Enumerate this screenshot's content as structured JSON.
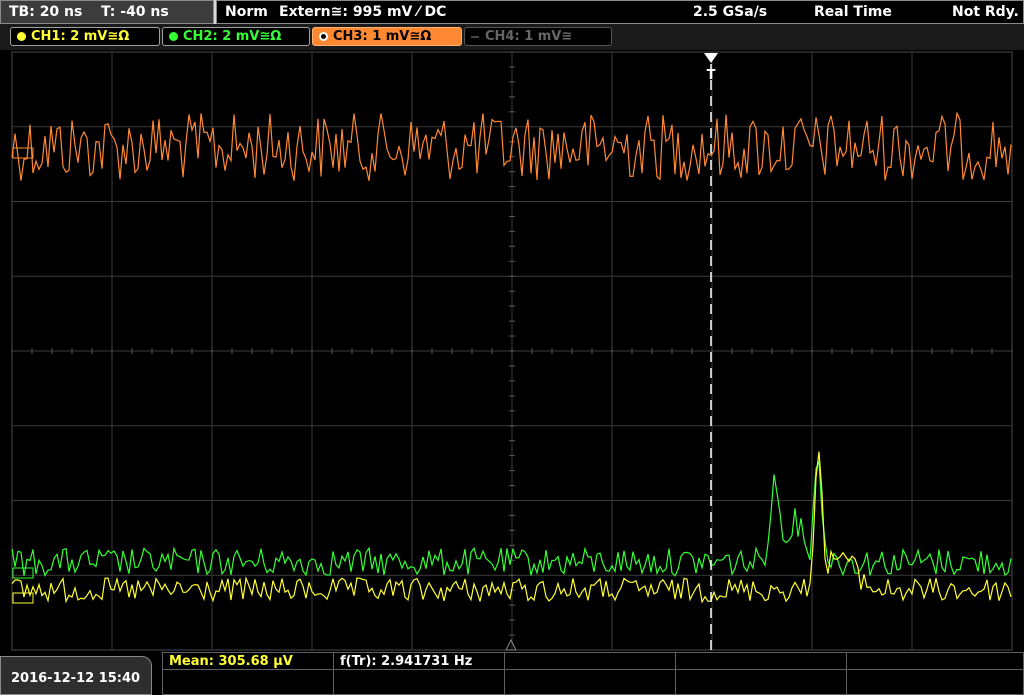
{
  "topbar": {
    "timebase": "TB: 20 ns",
    "trigger_time": "T: -40 ns",
    "mode": "Norm",
    "trigger_source": "Extern≅: 995 mV ⁄ DC",
    "sample_rate": "2.5 GSa/s",
    "acq_mode": "Real Time",
    "state": "Not Rdy."
  },
  "channels": [
    {
      "label": "CH1: 2 mV≅Ω",
      "color": "#ffff33",
      "active": true
    },
    {
      "label": "CH2: 2 mV≅Ω",
      "color": "#33ff33",
      "active": true
    },
    {
      "label": "CH3: 1 mV≅Ω",
      "color": "#ff8833",
      "active": true
    },
    {
      "label": "CH4: 1 mV≅",
      "color": "#777777",
      "active": false
    }
  ],
  "trigger_marker": "T",
  "measurements": {
    "mean": "Mean: 305.68 µV",
    "freq": "f(Tr): 2.941731 Hz"
  },
  "datetime": "2016-12-12 15:40",
  "colors": {
    "ch1": "#ffff33",
    "ch2": "#33ff33",
    "ch3": "#ff8833",
    "grid": "#3a3a3a"
  }
}
